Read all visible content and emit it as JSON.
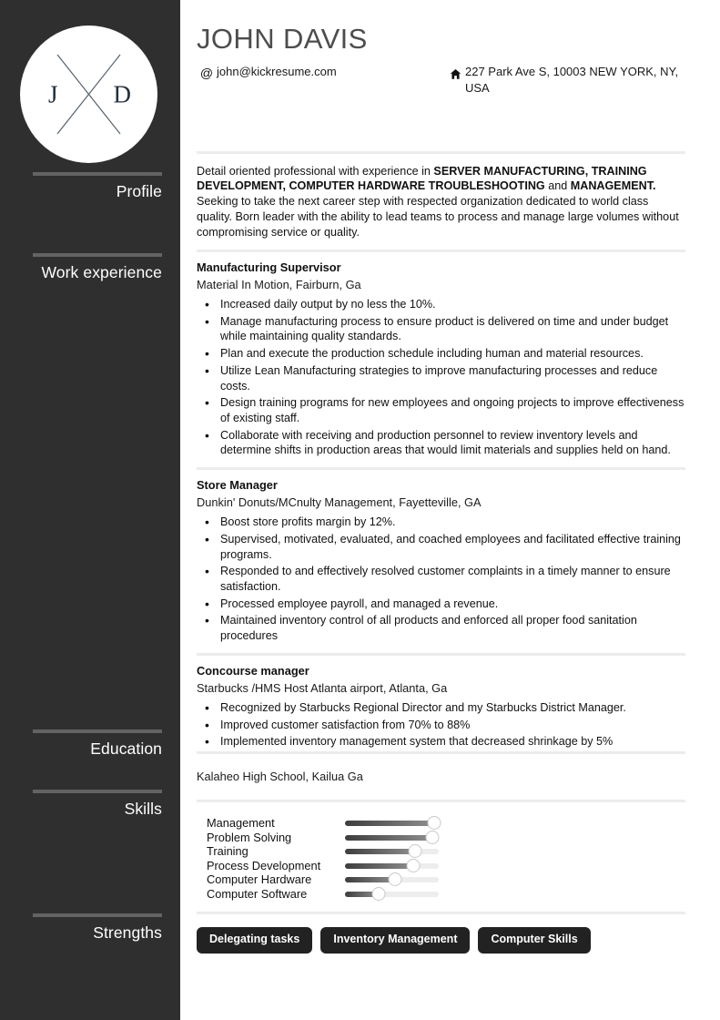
{
  "profile": {
    "name": "JOHN DAVIS",
    "monogram": {
      "left_letter": "J",
      "right_letter": "D",
      "icon": "x-cross-monogram"
    },
    "contacts": [
      {
        "icon": "at-sign-icon",
        "glyph": "@",
        "text": "john@kickresume.com"
      },
      {
        "icon": "home-icon",
        "glyph": "⌂",
        "text": "227 Park Ave S, 10003 NEW YORK, NY, USA"
      }
    ]
  },
  "sidebar": {
    "sections": [
      {
        "label": "Profile"
      },
      {
        "label": "Work experience"
      },
      {
        "label": "Education"
      },
      {
        "label": "Skills"
      },
      {
        "label": "Strengths"
      }
    ]
  },
  "summary": {
    "segments": [
      {
        "text": "Detail oriented professional with experience in ",
        "bold": false
      },
      {
        "text": "SERVER MANUFACTURING, TRAINING DEVELOPMENT, COMPUTER HARDWARE TROUBLESHOOTING",
        "bold": true
      },
      {
        "text": " and ",
        "bold": false
      },
      {
        "text": "MANAGEMENT.",
        "bold": true
      },
      {
        "text": " Seeking to take the next career step with respected organization dedicated to world class quality. Born leader with the ability to lead teams to process and manage large volumes without compromising service or quality.",
        "bold": false
      }
    ]
  },
  "work_experience": [
    {
      "title": "Manufacturing Supervisor",
      "organization": "Material In Motion, Fairburn, Ga",
      "bullets": [
        "Increased daily output by no less the 10%.",
        "Manage manufacturing process to ensure product is delivered on time and under budget while maintaining quality standards.",
        "Plan and execute the production schedule including human and material resources.",
        "Utilize Lean Manufacturing strategies to improve manufacturing processes and reduce costs.",
        "Design training programs for new employees and ongoing projects to improve effectiveness of existing staff.",
        "Collaborate with receiving and production personnel to review inventory levels and determine shifts in production areas that would limit materials and supplies held on hand."
      ]
    },
    {
      "title": "Store Manager",
      "organization": "Dunkin' Donuts/MCnulty Management, Fayetteville, GA",
      "bullets": [
        "Boost store profits margin by 12%.",
        "Supervised, motivated, evaluated, and coached employees and facilitated effective training programs.",
        "Responded to and effectively resolved customer complaints in a timely manner to ensure satisfaction.",
        "Processed employee payroll, and managed a revenue.",
        "Maintained inventory control of all products and enforced all proper food sanitation procedures"
      ]
    },
    {
      "title": "Concourse manager",
      "organization": "Starbucks /HMS Host Atlanta airport, Atlanta, Ga",
      "bullets": [
        "Recognized by Starbucks Regional Director and my Starbucks District Manager.",
        "Improved customer satisfaction from 70% to 88%",
        "Implemented inventory management system that decreased shrinkage by 5%"
      ]
    }
  ],
  "education": [
    {
      "text": "Kalaheo High School, Kailua Ga"
    }
  ],
  "skills": [
    {
      "name": "Management",
      "level": 95
    },
    {
      "name": "Problem Solving",
      "level": 93
    },
    {
      "name": "Training",
      "level": 75
    },
    {
      "name": "Process Development",
      "level": 73
    },
    {
      "name": "Computer Hardware",
      "level": 53
    },
    {
      "name": "Computer Software",
      "level": 36
    }
  ],
  "strengths": [
    {
      "label": "Delegating tasks"
    },
    {
      "label": "Inventory Management"
    },
    {
      "label": "Computer Skills"
    }
  ],
  "colors": {
    "sidebar_bg": "#2f2f2f",
    "sidebar_rule": "#636363",
    "name_color": "#4d4d4d",
    "divider": "#ececec",
    "tag_bg": "#222222",
    "slider_fill_dark": "#3d3d3d",
    "slider_track": "#ededed"
  }
}
